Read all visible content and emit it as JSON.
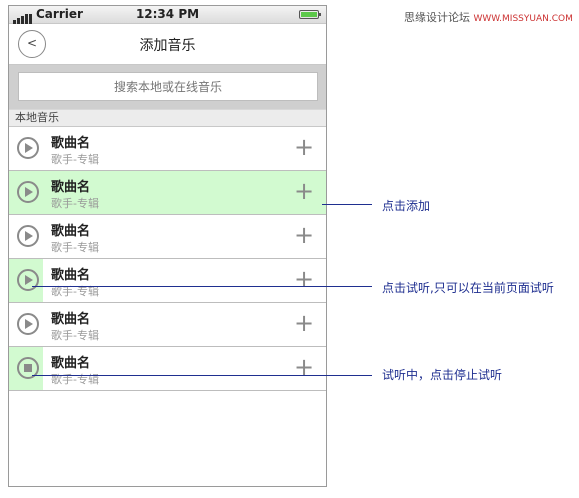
{
  "status_bar": {
    "carrier": "Carrier",
    "time": "12:34 PM"
  },
  "nav": {
    "back_glyph": "<",
    "title": "添加音乐"
  },
  "search": {
    "placeholder": "搜索本地或在线音乐"
  },
  "section": {
    "title": "本地音乐"
  },
  "songs": [
    {
      "title": "歌曲名",
      "subtitle": "歌手-专辑",
      "state": "play",
      "highlight": "none"
    },
    {
      "title": "歌曲名",
      "subtitle": "歌手-专辑",
      "state": "play",
      "highlight": "row"
    },
    {
      "title": "歌曲名",
      "subtitle": "歌手-专辑",
      "state": "play",
      "highlight": "none"
    },
    {
      "title": "歌曲名",
      "subtitle": "歌手-专辑",
      "state": "play",
      "highlight": "button"
    },
    {
      "title": "歌曲名",
      "subtitle": "歌手-专辑",
      "state": "play",
      "highlight": "none"
    },
    {
      "title": "歌曲名",
      "subtitle": "歌手-专辑",
      "state": "stop",
      "highlight": "button"
    }
  ],
  "add_glyph": "+",
  "annotations": {
    "add": "点击添加",
    "preview": "点击试听,只可以在当前页面试听",
    "previewing": "试听中，点击停止试听"
  },
  "watermark": {
    "cn": "思缘设计论坛",
    "en": "WWW.MISSYUAN.COM"
  },
  "colors": {
    "highlight": "#d2fad0",
    "annotation": "#1f2f90",
    "battery": "#5cc84a"
  }
}
